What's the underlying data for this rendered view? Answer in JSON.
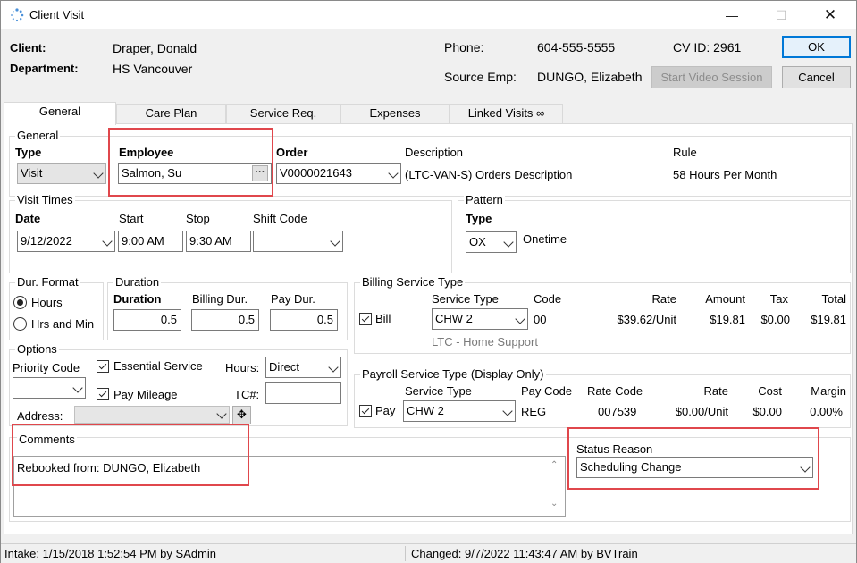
{
  "window": {
    "title": "Client Visit",
    "minimize": "—",
    "maximize": "☐",
    "close": "✕"
  },
  "header": {
    "client_label": "Client:",
    "client_value": "Draper, Donald",
    "department_label": "Department:",
    "department_value": "HS Vancouver",
    "phone_label": "Phone:",
    "phone_value": "604-555-5555",
    "cvid_label": "CV ID: 2961",
    "source_emp_label": "Source Emp:",
    "source_emp_value": "DUNGO, Elizabeth",
    "ok_label": "OK",
    "cancel_label": "Cancel",
    "video_label": "Start Video Session"
  },
  "tabs": [
    {
      "label": "General",
      "active": true
    },
    {
      "label": "Care Plan"
    },
    {
      "label": "Service Req."
    },
    {
      "label": "Expenses"
    },
    {
      "label": "Linked Visits ∞"
    }
  ],
  "general": {
    "group_title": "General",
    "type_label": "Type",
    "type_value": "Visit",
    "employee_label": "Employee",
    "employee_value": "Salmon, Su",
    "employee_btn": "···",
    "order_label": "Order",
    "order_value": "V0000021643",
    "description_label": "Description",
    "description_value": "(LTC-VAN-S) Orders Description",
    "rule_label": "Rule",
    "rule_value": "58 Hours Per Month"
  },
  "visit_times": {
    "group_title": "Visit Times",
    "date_label": "Date",
    "date_value": "9/12/2022",
    "start_label": "Start",
    "start_value": "9:00 AM",
    "stop_label": "Stop",
    "stop_value": "9:30 AM",
    "shift_label": "Shift Code",
    "shift_value": ""
  },
  "pattern": {
    "group_title": "Pattern",
    "type_label": "Type",
    "type_value": "OX",
    "type_desc": "Onetime"
  },
  "dur_format": {
    "group_title": "Dur. Format",
    "hours_label": "Hours",
    "hrs_min_label": "Hrs and Min"
  },
  "duration": {
    "group_title": "Duration",
    "duration_label": "Duration",
    "duration_value": "0.5",
    "billing_label": "Billing Dur.",
    "billing_value": "0.5",
    "pay_label": "Pay Dur.",
    "pay_value": "0.5"
  },
  "billing": {
    "group_title": "Billing Service Type",
    "service_type_label": "Service Type",
    "code_label": "Code",
    "rate_label": "Rate",
    "amount_label": "Amount",
    "tax_label": "Tax",
    "total_label": "Total",
    "bill_label": "Bill",
    "service_type_value": "CHW 2",
    "code_value": "00",
    "rate_value": "$39.62/Unit",
    "amount_value": "$19.81",
    "tax_value": "$0.00",
    "total_value": "$19.81",
    "service_desc": "LTC - Home Support"
  },
  "options": {
    "group_title": "Options",
    "priority_label": "Priority Code",
    "priority_value": "",
    "essential_label": "Essential Service",
    "hours_label": "Hours:",
    "hours_value": "Direct",
    "mileage_label": "Pay Mileage",
    "tc_label": "TC#:",
    "tc_value": "",
    "address_label": "Address:",
    "address_value": "",
    "address_btn": "✥"
  },
  "payroll": {
    "group_title": "Payroll Service Type (Display Only)",
    "service_type_label": "Service Type",
    "pay_code_label": "Pay Code",
    "rate_code_label": "Rate Code",
    "rate_label": "Rate",
    "cost_label": "Cost",
    "margin_label": "Margin",
    "pay_label": "Pay",
    "service_type_value": "CHW 2",
    "pay_code_value": "REG",
    "rate_code_value": "007539",
    "rate_value": "$0.00/Unit",
    "cost_value": "$0.00",
    "margin_value": "0.00%"
  },
  "comments": {
    "group_title": "Comments",
    "text": "Rebooked from: DUNGO, Elizabeth"
  },
  "status_reason": {
    "label": "Status Reason",
    "value": "Scheduling Change"
  },
  "statusbar": {
    "intake": "Intake: 1/15/2018 1:52:54 PM by SAdmin",
    "changed": "Changed: 9/7/2022 11:43:47 AM by BVTrain"
  },
  "colors": {
    "highlight_box": "#e0474c",
    "ok_border": "#0078d7"
  }
}
